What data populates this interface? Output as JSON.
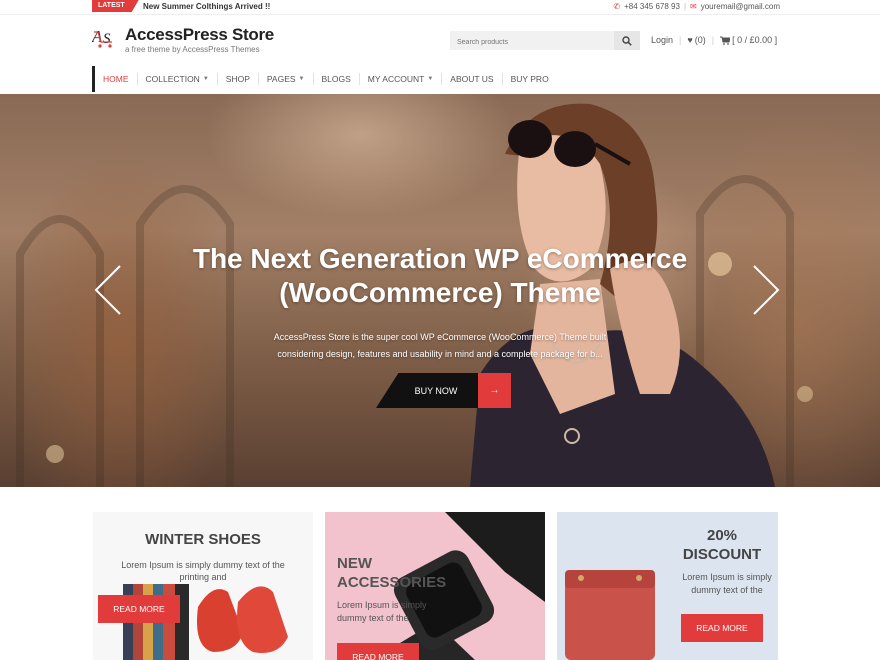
{
  "topbar": {
    "latest_label": "LATEST",
    "ticker": "New Summer Colthings Arrived !!",
    "phone": "+84 345 678 93",
    "email": "youremail@gmail.com",
    "phone_icon": "phone-icon",
    "email_icon": "envelope-icon"
  },
  "header": {
    "site_title": "AccessPress Store",
    "site_description": "a free theme by AccessPress Themes",
    "search_placeholder": "Search products",
    "login": "Login",
    "wishlist": "(0)",
    "cart": "[ 0 / £0.00 ]"
  },
  "nav": {
    "items": [
      {
        "label": "HOME",
        "active": true,
        "dropdown": false
      },
      {
        "label": "COLLECTION",
        "active": false,
        "dropdown": true
      },
      {
        "label": "SHOP",
        "active": false,
        "dropdown": false
      },
      {
        "label": "PAGES",
        "active": false,
        "dropdown": true
      },
      {
        "label": "BLOGS",
        "active": false,
        "dropdown": false
      },
      {
        "label": "MY ACCOUNT",
        "active": false,
        "dropdown": true
      },
      {
        "label": "ABOUT US",
        "active": false,
        "dropdown": false
      },
      {
        "label": "BUY PRO",
        "active": false,
        "dropdown": false
      }
    ]
  },
  "hero": {
    "title_line1": "The Next Generation WP eCommerce",
    "title_line2": "(WooCommerce) Theme",
    "text_line1": "AccessPress Store is the super cool WP eCommerce (WooCommerce) Theme  built",
    "text_line2": "considering design, features and usability in mind and a complete package for b...",
    "button": "BUY NOW",
    "button_arrow": "→"
  },
  "promos": {
    "card1": {
      "title": "WINTER SHOES",
      "text": "Lorem Ipsum is simply dummy text of the printing and",
      "button": "READ MORE"
    },
    "card2": {
      "title_line1": "NEW",
      "title_line2": "ACCESSORIES",
      "text": "Lorem Ipsum is simply dummy text of the",
      "button": "READ MORE"
    },
    "card3": {
      "title_line1": "20%",
      "title_line2": "DISCOUNT",
      "text": "Lorem Ipsum is simply dummy text of the",
      "button": "READ MORE"
    }
  },
  "colors": {
    "accent": "#e23b3b",
    "dark": "#111111"
  }
}
